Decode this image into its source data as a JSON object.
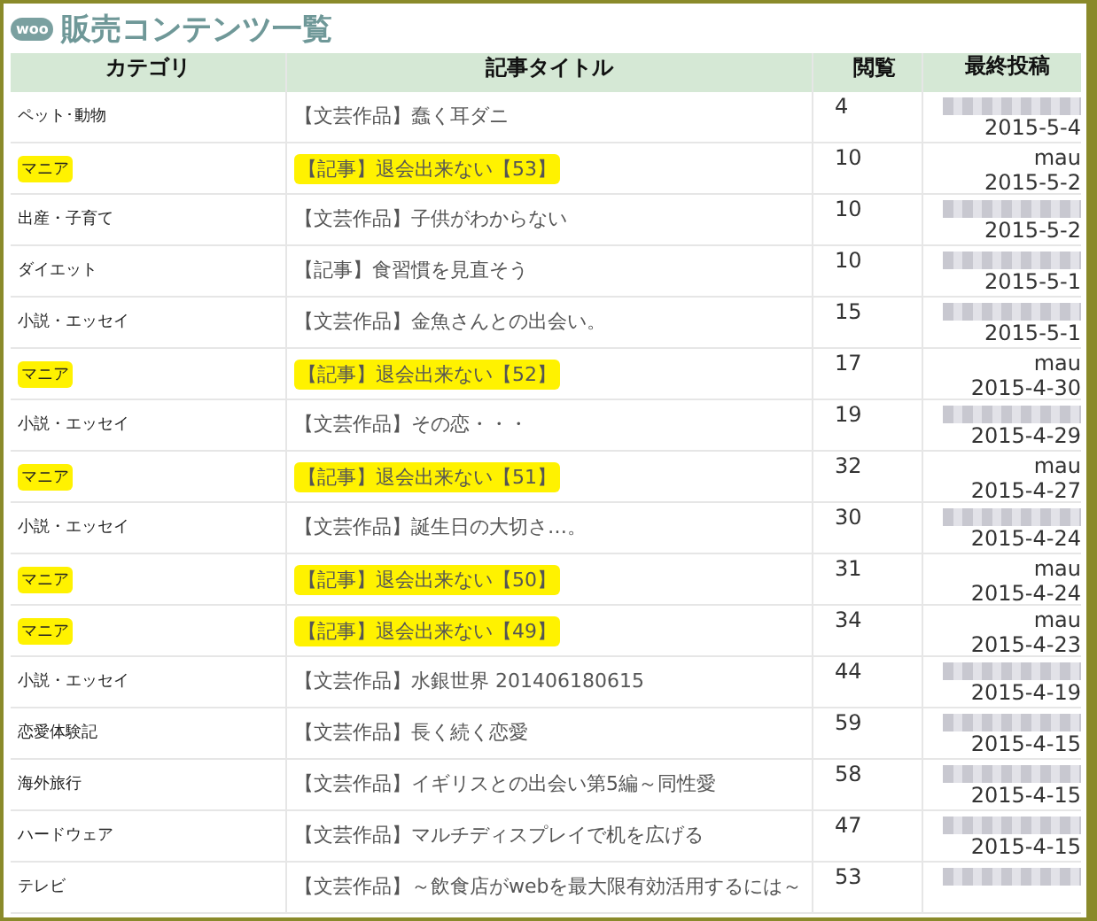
{
  "page_title": "販売コンテンツ一覧",
  "logo": {
    "text": "woo"
  },
  "table": {
    "columns": [
      "カテゴリ",
      "記事タイトル",
      "閲覧",
      "最終投稿"
    ],
    "rows": [
      {
        "category": "ペット･動物",
        "title": "【文芸作品】蠢く耳ダニ",
        "views": "4",
        "author": null,
        "date": "2015-5-4",
        "highlighted": false
      },
      {
        "category": "マニア",
        "title": "【記事】退会出来ない【53】",
        "views": "10",
        "author": "mau",
        "date": "2015-5-2",
        "highlighted": true
      },
      {
        "category": "出産・子育て",
        "title": "【文芸作品】子供がわからない",
        "views": "10",
        "author": null,
        "date": "2015-5-2",
        "highlighted": false
      },
      {
        "category": "ダイエット",
        "title": "【記事】食習慣を見直そう",
        "views": "10",
        "author": null,
        "date": "2015-5-1",
        "highlighted": false
      },
      {
        "category": "小説・エッセイ",
        "title": "【文芸作品】金魚さんとの出会い。",
        "views": "15",
        "author": null,
        "date": "2015-5-1",
        "highlighted": false
      },
      {
        "category": "マニア",
        "title": "【記事】退会出来ない【52】",
        "views": "17",
        "author": "mau",
        "date": "2015-4-30",
        "highlighted": true
      },
      {
        "category": "小説・エッセイ",
        "title": "【文芸作品】その恋・・・",
        "views": "19",
        "author": null,
        "date": "2015-4-29",
        "highlighted": false
      },
      {
        "category": "マニア",
        "title": "【記事】退会出来ない【51】",
        "views": "32",
        "author": "mau",
        "date": "2015-4-27",
        "highlighted": true
      },
      {
        "category": "小説・エッセイ",
        "title": "【文芸作品】誕生日の大切さ…。",
        "views": "30",
        "author": null,
        "date": "2015-4-24",
        "highlighted": false
      },
      {
        "category": "マニア",
        "title": "【記事】退会出来ない【50】",
        "views": "31",
        "author": "mau",
        "date": "2015-4-24",
        "highlighted": true
      },
      {
        "category": "マニア",
        "title": "【記事】退会出来ない【49】",
        "views": "34",
        "author": "mau",
        "date": "2015-4-23",
        "highlighted": true
      },
      {
        "category": "小説・エッセイ",
        "title": "【文芸作品】水銀世界 201406180615",
        "views": "44",
        "author": null,
        "date": "2015-4-19",
        "highlighted": false
      },
      {
        "category": "恋愛体験記",
        "title": "【文芸作品】長く続く恋愛",
        "views": "59",
        "author": null,
        "date": "2015-4-15",
        "highlighted": false
      },
      {
        "category": "海外旅行",
        "title": "【文芸作品】イギリスとの出会い第5編～同性愛",
        "views": "58",
        "author": null,
        "date": "2015-4-15",
        "highlighted": false
      },
      {
        "category": "ハードウェア",
        "title": "【文芸作品】マルチディスプレイで机を広げる",
        "views": "47",
        "author": null,
        "date": "2015-4-15",
        "highlighted": false
      },
      {
        "category": "テレビ",
        "title": "【文芸作品】～飲食店がwebを最大限有効活用するには～",
        "views": "53",
        "author": null,
        "date": null,
        "highlighted": false
      }
    ]
  }
}
